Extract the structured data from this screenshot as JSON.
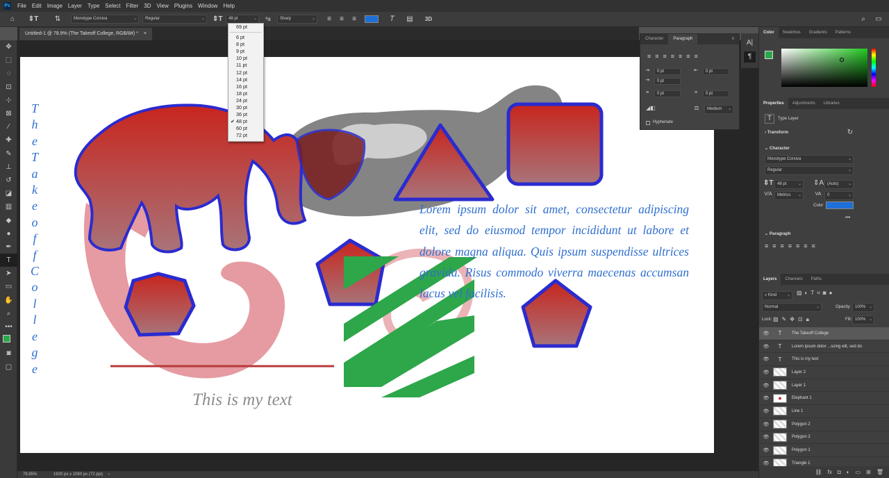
{
  "app": {
    "logo": "Ps"
  },
  "menu": [
    "File",
    "Edit",
    "Image",
    "Layer",
    "Type",
    "Select",
    "Filter",
    "3D",
    "View",
    "Plugins",
    "Window",
    "Help"
  ],
  "options": {
    "font_family": "Monotype Corsiva",
    "font_style": "Regular",
    "font_size": "48 pt",
    "antialias": "Sharp",
    "color": "#1f6fd9",
    "three_d": "3D"
  },
  "size_menu": {
    "top": "69 pt",
    "items": [
      "6 pt",
      "8 pt",
      "9 pt",
      "10 pt",
      "11 pt",
      "12 pt",
      "14 pt",
      "16 pt",
      "18 pt",
      "24 pt",
      "30 pt",
      "36 pt",
      "48 pt",
      "60 pt",
      "72 pt"
    ],
    "checked": "48 pt",
    "check_mark": "✔"
  },
  "document": {
    "tab_label": "Untitled-1 @ 78.9% (The Takeoff College, RGB/8#) *"
  },
  "canvas_text": {
    "vertical_letters": [
      "T",
      "h",
      "e",
      "T",
      "a",
      "k",
      "e",
      "o",
      "f",
      "f",
      "C",
      "o",
      "l",
      "l",
      "e",
      "g",
      "e"
    ],
    "lorem": "Lorem ipsum dolor sit amet, consectetur adipiscing elit, sed do eiusmod tempor incididunt ut labore et dolore magna aliqua. Quis ipsum suspendisse ultrices gravida. Risus commodo viverra maecenas accumsan lacus vel facilisis.",
    "my_text": "This is my text"
  },
  "status": {
    "zoom": "78.85%",
    "doc_info": "1920 px x 1080 px (72 ppi)"
  },
  "paragraph_panel": {
    "tabs": [
      "Character",
      "Paragraph"
    ],
    "active_tab": "Paragraph",
    "indent_left": "0 pt",
    "indent_right": "0 pt",
    "indent_first": "0 pt",
    "space_before": "0 pt",
    "space_after": "0 pt",
    "composer": "Medium",
    "hyphenate": "Hyphenate"
  },
  "color_panel": {
    "tabs": [
      "Color",
      "Swatches",
      "Gradients",
      "Patterns"
    ],
    "foreground": "#2aa84a"
  },
  "properties": {
    "tabs": [
      "Properties",
      "Adjustments",
      "Libraries"
    ],
    "layer_type": "Type Layer",
    "transform": "Transform",
    "character": "Character",
    "font": "Monotype Corsiva",
    "style": "Regular",
    "size": "48 pt",
    "leading": "(Auto)",
    "kerning": "Metrics",
    "tracking": "0",
    "color_label": "Color",
    "color": "#1f6fd9",
    "more": "•••",
    "paragraph": "Paragraph"
  },
  "layers_panel": {
    "tabs": [
      "Layers",
      "Channels",
      "Paths"
    ],
    "filter": "Kind",
    "blend_mode": "Normal",
    "opacity_label": "Opacity:",
    "opacity": "100%",
    "lock_label": "Lock:",
    "fill_label": "Fill:",
    "fill": "100%",
    "layers": [
      {
        "name": "The Takeoff College",
        "kind": "text",
        "selected": true
      },
      {
        "name": "Lorem ipsum dolor ...scing elit, sed do",
        "kind": "text"
      },
      {
        "name": "This is my text",
        "kind": "text"
      },
      {
        "name": "Layer 2",
        "kind": "pixel"
      },
      {
        "name": "Layer 1",
        "kind": "pixel"
      },
      {
        "name": "Elephant 1",
        "kind": "shape"
      },
      {
        "name": "Line 1",
        "kind": "shape"
      },
      {
        "name": "Polygon 2",
        "kind": "shape"
      },
      {
        "name": "Polygon 2",
        "kind": "shape"
      },
      {
        "name": "Polygon 1",
        "kind": "shape"
      },
      {
        "name": "Triangle 1",
        "kind": "shape"
      }
    ],
    "footer_icons": [
      "link-icon",
      "fx-icon",
      "mask-icon",
      "adjustment-icon",
      "folder-icon",
      "new-layer-icon",
      "trash-icon"
    ]
  }
}
